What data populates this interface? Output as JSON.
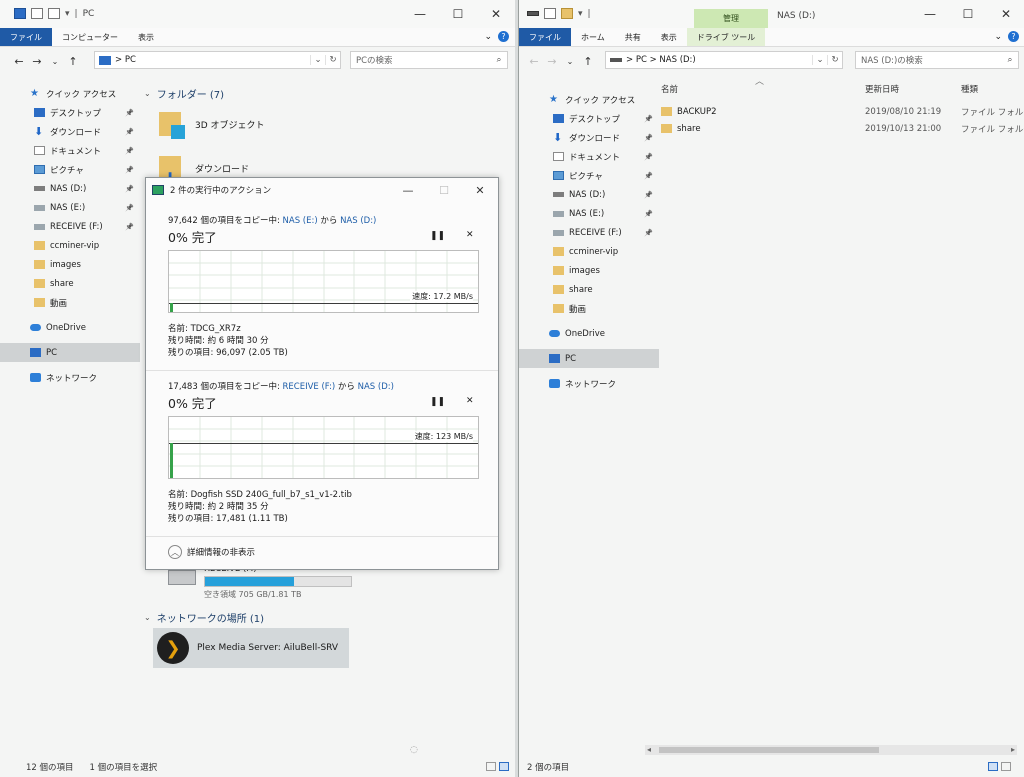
{
  "left": {
    "title": "PC",
    "tabs": [
      "ファイル",
      "コンピューター",
      "表示"
    ],
    "address": "PC",
    "search_placeholder": "PCの検索",
    "nav": [
      {
        "label": "クイック アクセス",
        "icon": "star-icon",
        "pin": false
      },
      {
        "label": "デスクトップ",
        "icon": "desktop-icon",
        "pin": true
      },
      {
        "label": "ダウンロード",
        "icon": "download-icon",
        "pin": true
      },
      {
        "label": "ドキュメント",
        "icon": "document-icon",
        "pin": true
      },
      {
        "label": "ピクチャ",
        "icon": "pictures-icon",
        "pin": true
      },
      {
        "label": "NAS (D:)",
        "icon": "drive-icon",
        "pin": true
      },
      {
        "label": "NAS (E:)",
        "icon": "network-drive-icon",
        "pin": true
      },
      {
        "label": "RECEIVE (F:)",
        "icon": "network-drive-icon",
        "pin": true
      },
      {
        "label": "ccminer-vip",
        "icon": "folder-icon",
        "pin": false
      },
      {
        "label": "images",
        "icon": "folder-icon",
        "pin": false
      },
      {
        "label": "share",
        "icon": "folder-icon",
        "pin": false
      },
      {
        "label": "動画",
        "icon": "folder-icon",
        "pin": false
      },
      {
        "label": "OneDrive",
        "icon": "onedrive-icon",
        "pin": false
      },
      {
        "label": "PC",
        "icon": "pc-icon",
        "pin": false,
        "selected": true
      },
      {
        "label": "ネットワーク",
        "icon": "network-icon",
        "pin": false
      }
    ],
    "folders_group": "フォルダー (7)",
    "folders": [
      "3D オブジェクト",
      "ダウンロード"
    ],
    "drive": {
      "name": "RECEIVE (F:)",
      "free": "空き領域 705 GB/1.81 TB",
      "used_fraction": 0.61
    },
    "network_group": "ネットワークの場所 (1)",
    "network_item": "Plex Media Server: AiluBell-SRV",
    "status_count": "12 個の項目",
    "status_selected": "1 個の項目を選択"
  },
  "right": {
    "title": "NAS (D:)",
    "manage_tab": "管理",
    "tabs": [
      "ファイル",
      "ホーム",
      "共有",
      "表示",
      "ドライブ ツール"
    ],
    "address": [
      "PC",
      "NAS (D:)"
    ],
    "search_placeholder": "NAS (D:)の検索",
    "nav": [
      {
        "label": "クイック アクセス",
        "icon": "star-icon",
        "pin": false
      },
      {
        "label": "デスクトップ",
        "icon": "desktop-icon",
        "pin": true
      },
      {
        "label": "ダウンロード",
        "icon": "download-icon",
        "pin": true
      },
      {
        "label": "ドキュメント",
        "icon": "document-icon",
        "pin": true
      },
      {
        "label": "ピクチャ",
        "icon": "pictures-icon",
        "pin": true
      },
      {
        "label": "NAS (D:)",
        "icon": "drive-icon",
        "pin": true
      },
      {
        "label": "NAS (E:)",
        "icon": "network-drive-icon",
        "pin": true
      },
      {
        "label": "RECEIVE (F:)",
        "icon": "network-drive-icon",
        "pin": true
      },
      {
        "label": "ccminer-vip",
        "icon": "folder-icon",
        "pin": false
      },
      {
        "label": "images",
        "icon": "folder-icon",
        "pin": false
      },
      {
        "label": "share",
        "icon": "folder-icon",
        "pin": false
      },
      {
        "label": "動画",
        "icon": "folder-icon",
        "pin": false
      },
      {
        "label": "OneDrive",
        "icon": "onedrive-icon",
        "pin": false
      },
      {
        "label": "PC",
        "icon": "pc-icon",
        "pin": false,
        "selected": true
      },
      {
        "label": "ネットワーク",
        "icon": "network-icon",
        "pin": false
      }
    ],
    "columns": [
      "名前",
      "更新日時",
      "種類"
    ],
    "files": [
      {
        "name": "BACKUP2",
        "date": "2019/08/10 21:19",
        "type": "ファイル フォルダー"
      },
      {
        "name": "share",
        "date": "2019/10/13 21:00",
        "type": "ファイル フォルダー"
      }
    ],
    "status_count": "2 個の項目"
  },
  "dialog": {
    "title": "2 件の実行中のアクション",
    "detail_toggle": "詳細情報の非表示",
    "operations": [
      {
        "count_text": "97,642 個の項目をコピー中: ",
        "source": "NAS (E:)",
        "from_word": " から ",
        "dest": "NAS (D:)",
        "percent": "0% 完了",
        "speed": "速度: 17.2 MB/s",
        "speed_fraction": 0.14,
        "name": "名前: TDCG_XR7z",
        "remaining_time": "残り時間: 約 6 時間 30 分",
        "remaining_items": "残りの項目: 96,097 (2.05 TB)"
      },
      {
        "count_text": "17,483 個の項目をコピー中: ",
        "source": "RECEIVE (F:)",
        "from_word": " から ",
        "dest": "NAS (D:)",
        "percent": "0% 完了",
        "speed": "速度: 123 MB/s",
        "speed_fraction": 0.58,
        "name": "名前: Dogfish SSD 240G_full_b7_s1_v1-2.tib",
        "remaining_time": "残り時間: 約 2 時間 35 分",
        "remaining_items": "残りの項目: 17,481 (1.11 TB)"
      }
    ]
  }
}
